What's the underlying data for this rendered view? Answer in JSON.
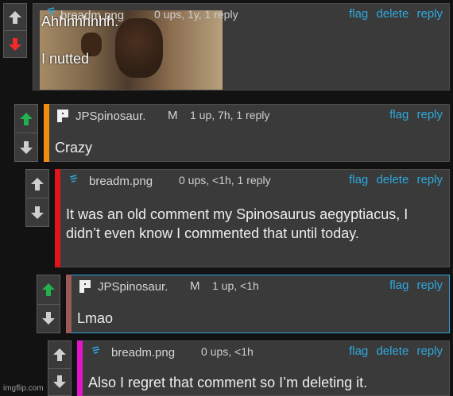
{
  "comments": [
    {
      "id": "c1",
      "username": "breadm.png",
      "mod_badge": "",
      "meta": "0 ups, 1y, 1 reply",
      "actions": [
        "flag",
        "delete",
        "reply"
      ],
      "vote_state": "down",
      "image": {
        "icon": "meme-image-thumbnail",
        "caption_top": "Ahhhhhhhh.",
        "caption_bottom": "I nutted"
      },
      "body": "",
      "accent_color": ""
    },
    {
      "id": "c2",
      "username": "JPSpinosaur.",
      "mod_badge": "M",
      "meta": "1 up, 7h, 1 reply",
      "actions": [
        "flag",
        "reply"
      ],
      "vote_state": "up",
      "body": "Crazy",
      "accent_color": "#f28c10"
    },
    {
      "id": "c3",
      "username": "breadm.png",
      "mod_badge": "",
      "meta": "0 ups, <1h, 1 reply",
      "actions": [
        "flag",
        "delete",
        "reply"
      ],
      "vote_state": "none",
      "body": "It was an old comment my Spinosaurus aegyptiacus, I didn’t even know I commented that until today.",
      "accent_color": "#e0151c"
    },
    {
      "id": "c4",
      "username": "JPSpinosaur.",
      "mod_badge": "M",
      "meta": "1 up, <1h",
      "actions": [
        "flag",
        "reply"
      ],
      "vote_state": "up",
      "body": "Lmao",
      "accent_color": "#9b5a5a"
    },
    {
      "id": "c5",
      "username": "breadm.png",
      "mod_badge": "",
      "meta": "0 ups, <1h",
      "actions": [
        "flag",
        "delete",
        "reply"
      ],
      "vote_state": "none",
      "body": "Also I regret that comment so I’m deleting it.",
      "accent_color": "#e116c8"
    }
  ],
  "watermark": "imgflip.com",
  "colors": {
    "upvote_active": "#22b14c",
    "downvote_active": "#ee2a2a",
    "vote_inactive": "#cfcfcf",
    "link": "#2fa8dd",
    "selected_border": "#2aa3d6"
  },
  "icons": {
    "upvote": "up-arrow-icon",
    "downvote": "down-arrow-icon",
    "avatar_breadm": "blue-squiggle-avatar-icon",
    "avatar_jp": "pixel-block-avatar-icon"
  }
}
